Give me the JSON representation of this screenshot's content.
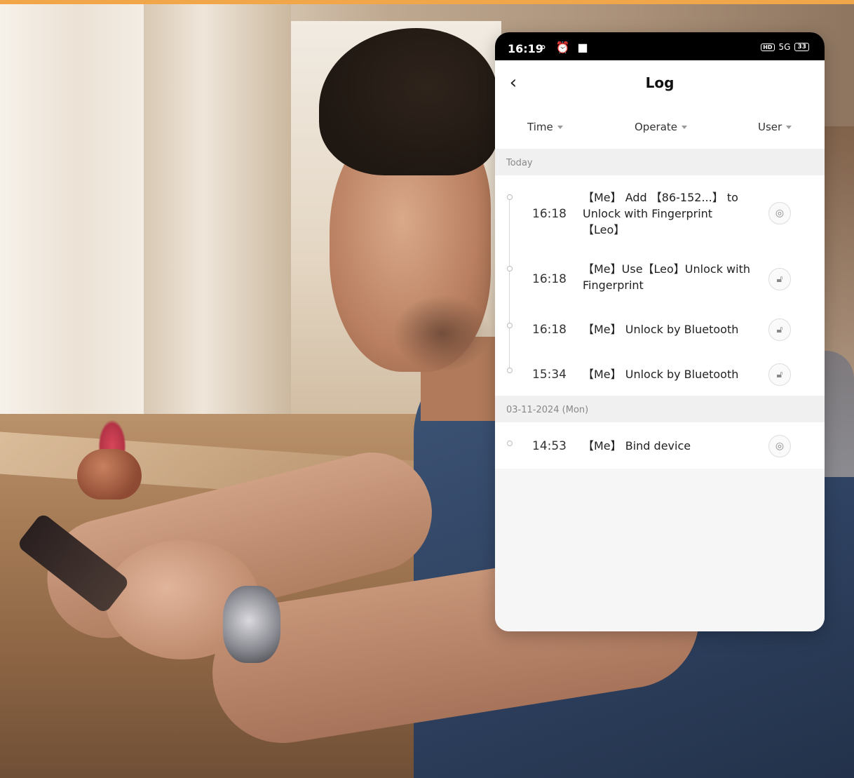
{
  "status_bar": {
    "time": "16:19",
    "left_icons": "⚬ ⏰ ■",
    "hd": "HD",
    "signal": "5G",
    "battery": "33"
  },
  "header": {
    "back_label": "‹",
    "title": "Log"
  },
  "filters": {
    "time": "Time",
    "operate": "Operate",
    "user": "User"
  },
  "sections": [
    {
      "label": "Today",
      "entries": [
        {
          "time": "16:18",
          "text": "【Me】 Add 【86-152...】 to Unlock with Fingerprint 【Leo】",
          "icon": "settings-icon"
        },
        {
          "time": "16:18",
          "text": "【Me】Use【Leo】Unlock with Fingerprint",
          "icon": "unlock-icon"
        },
        {
          "time": "16:18",
          "text": "【Me】 Unlock by Bluetooth",
          "icon": "unlock-icon"
        },
        {
          "time": "15:34",
          "text": "【Me】 Unlock by Bluetooth",
          "icon": "unlock-icon"
        }
      ]
    },
    {
      "label": "03-11-2024 (Mon)",
      "entries": [
        {
          "time": "14:53",
          "text": "【Me】 Bind device",
          "icon": "settings-icon"
        }
      ]
    }
  ],
  "colors": {
    "accent_bar": "#f2a64a",
    "panel_bg": "#f6f6f6"
  }
}
